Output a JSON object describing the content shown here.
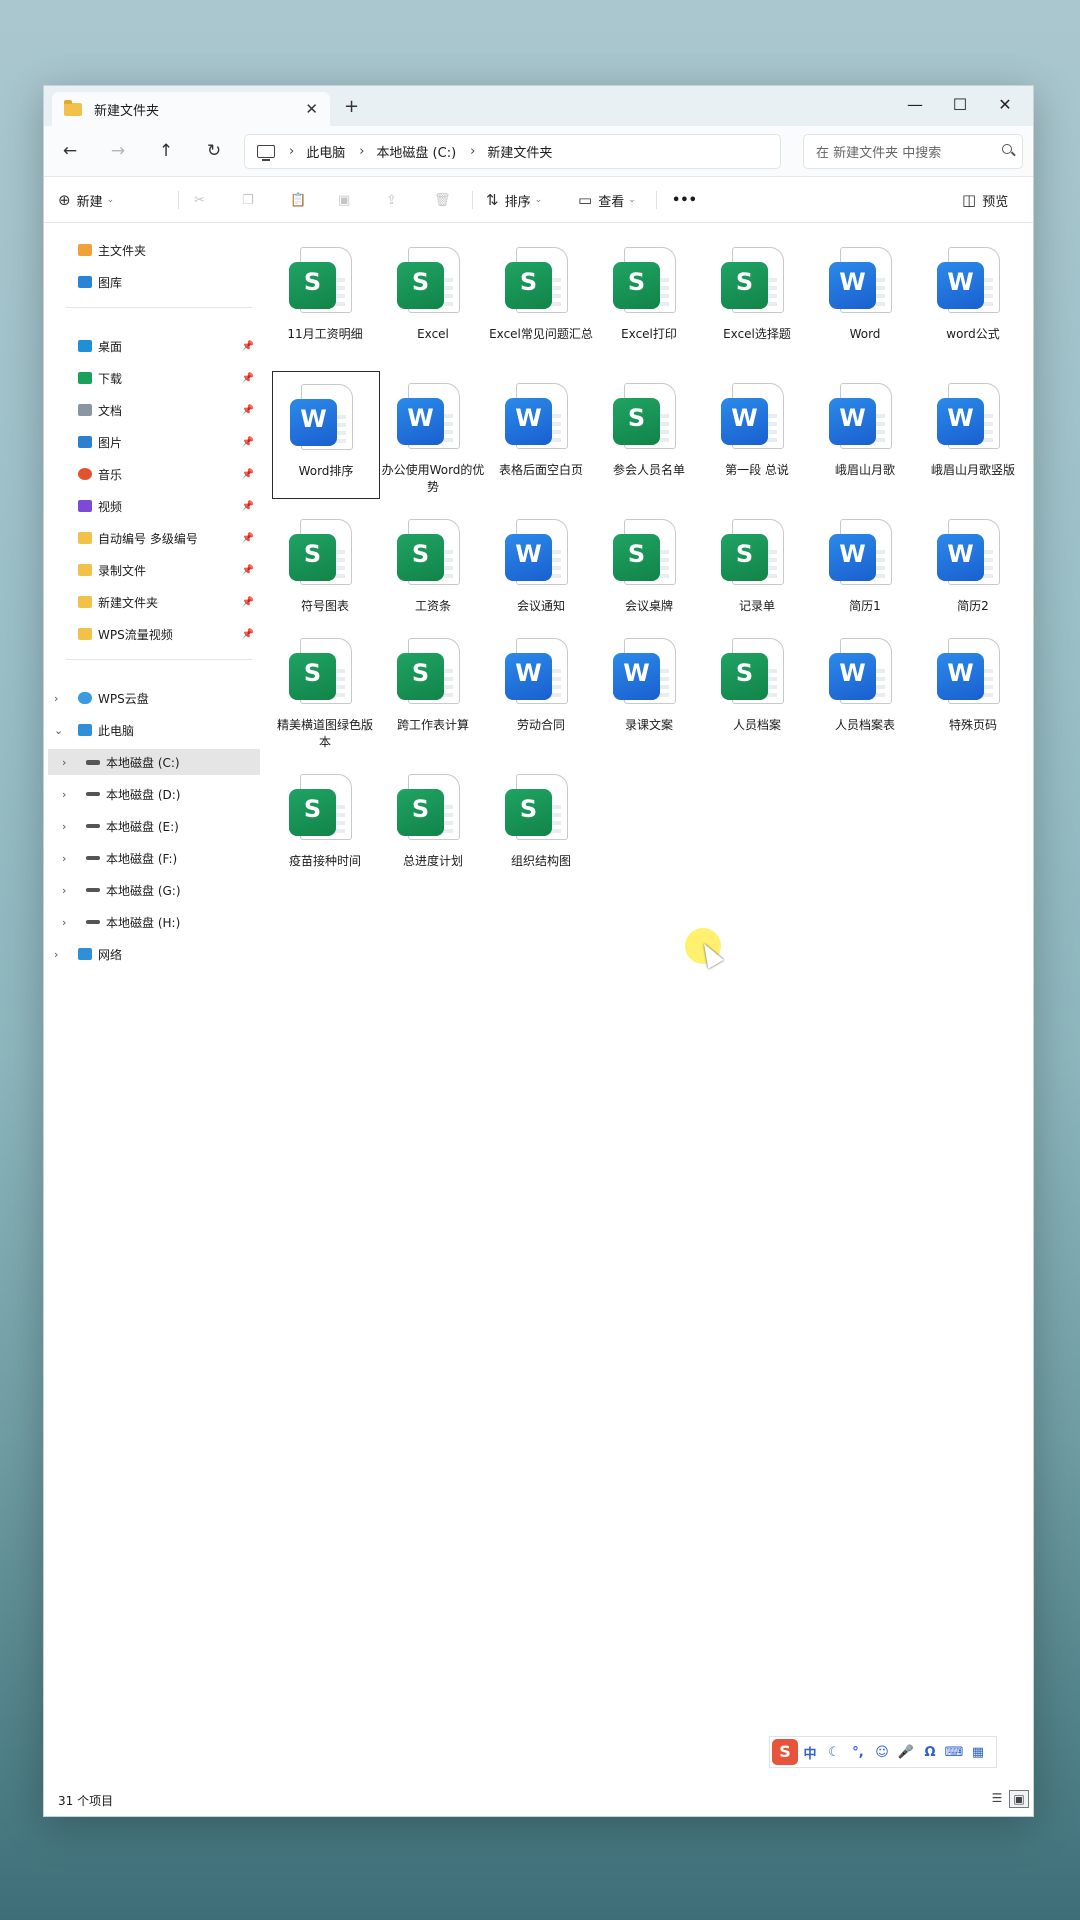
{
  "window": {
    "tab_title": "新建文件夹",
    "tab_close": "✕",
    "new_tab": "+",
    "controls": {
      "minimize": "—",
      "maximize": "☐",
      "close": "✕"
    }
  },
  "nav": {
    "back": "←",
    "forward": "→",
    "up": "↑",
    "refresh": "↻",
    "breadcrumb": [
      "此电脑",
      "本地磁盘 (C:)",
      "新建文件夹"
    ],
    "separator": "›",
    "search_placeholder": "在 新建文件夹 中搜索"
  },
  "toolbar": {
    "new": "新建",
    "sort": "排序",
    "view": "查看",
    "more": "•••",
    "preview": "预览",
    "icons": [
      "cut-icon",
      "copy-icon",
      "paste-icon",
      "rename-icon",
      "share-icon",
      "delete-icon"
    ]
  },
  "sidebar": {
    "quick": [
      {
        "label": "主文件夹",
        "icon": "home-icon"
      },
      {
        "label": "图库",
        "icon": "gallery-icon"
      }
    ],
    "pinned": [
      {
        "label": "桌面",
        "icon": "desktop-icon"
      },
      {
        "label": "下载",
        "icon": "download-icon"
      },
      {
        "label": "文档",
        "icon": "documents-icon"
      },
      {
        "label": "图片",
        "icon": "pictures-icon"
      },
      {
        "label": "音乐",
        "icon": "music-icon"
      },
      {
        "label": "视频",
        "icon": "videos-icon"
      },
      {
        "label": "自动编号 多级编号",
        "icon": "folder-icon"
      },
      {
        "label": "录制文件",
        "icon": "folder-icon"
      },
      {
        "label": "新建文件夹",
        "icon": "folder-icon"
      },
      {
        "label": "WPS流量视频",
        "icon": "folder-icon"
      }
    ],
    "tree": [
      {
        "label": "WPS云盘",
        "icon": "cloud-icon",
        "expander": "›"
      },
      {
        "label": "此电脑",
        "icon": "pc-icon",
        "expander": "⌄"
      },
      {
        "label": "本地磁盘 (C:)",
        "icon": "drive-icon",
        "expander": "›"
      },
      {
        "label": "本地磁盘 (D:)",
        "icon": "drive-icon",
        "expander": "›"
      },
      {
        "label": "本地磁盘 (E:)",
        "icon": "drive-icon",
        "expander": "›"
      },
      {
        "label": "本地磁盘 (F:)",
        "icon": "drive-icon",
        "expander": "›"
      },
      {
        "label": "本地磁盘 (G:)",
        "icon": "drive-icon",
        "expander": "›"
      },
      {
        "label": "本地磁盘 (H:)",
        "icon": "drive-icon",
        "expander": "›"
      },
      {
        "label": "网络",
        "icon": "network-icon",
        "expander": "›"
      }
    ]
  },
  "files": [
    {
      "name": "11月工资明细",
      "type": "S"
    },
    {
      "name": "Excel",
      "type": "S"
    },
    {
      "name": "Excel常见问题汇总",
      "type": "S"
    },
    {
      "name": "Excel打印",
      "type": "S"
    },
    {
      "name": "Excel选择题",
      "type": "S"
    },
    {
      "name": "Word",
      "type": "W"
    },
    {
      "name": "word公式",
      "type": "W"
    },
    {
      "name": "Word排序",
      "type": "W"
    },
    {
      "name": "办公使用Word的优势",
      "type": "W"
    },
    {
      "name": "表格后面空白页",
      "type": "W"
    },
    {
      "name": "参会人员名单",
      "type": "S"
    },
    {
      "name": "第一段 总说",
      "type": "W"
    },
    {
      "name": "峨眉山月歌",
      "type": "W"
    },
    {
      "name": "峨眉山月歌竖版",
      "type": "W"
    },
    {
      "name": "符号图表",
      "type": "S"
    },
    {
      "name": "工资条",
      "type": "S"
    },
    {
      "name": "会议通知",
      "type": "W"
    },
    {
      "name": "会议桌牌",
      "type": "S"
    },
    {
      "name": "记录单",
      "type": "S"
    },
    {
      "name": "简历1",
      "type": "W"
    },
    {
      "name": "简历2",
      "type": "W"
    },
    {
      "name": "精美横道图绿色版本",
      "type": "S"
    },
    {
      "name": "跨工作表计算",
      "type": "S"
    },
    {
      "name": "劳动合同",
      "type": "W"
    },
    {
      "name": "录课文案",
      "type": "W"
    },
    {
      "name": "人员档案",
      "type": "S"
    },
    {
      "name": "人员档案表",
      "type": "W"
    },
    {
      "name": "特殊页码",
      "type": "W"
    },
    {
      "name": "疫苗接种时间",
      "type": "S"
    },
    {
      "name": "总进度计划",
      "type": "S"
    },
    {
      "name": "组织结构图",
      "type": "S"
    }
  ],
  "status": {
    "count": "31 个项目"
  },
  "ime": {
    "logo": "S",
    "icons": [
      "中",
      "☾",
      "°,",
      "☺",
      "🎤",
      "Ω",
      "⌨",
      "▦"
    ]
  },
  "colors": {
    "sheet": "#17935a",
    "word": "#2274dd",
    "accent": "#005fb8"
  }
}
